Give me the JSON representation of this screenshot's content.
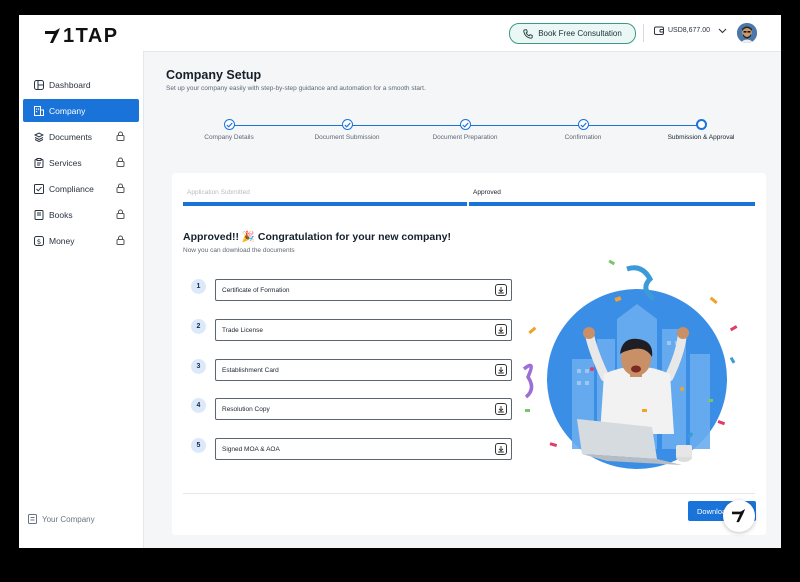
{
  "brand": {
    "logo_text": "1TAP"
  },
  "sidebar": {
    "items": [
      {
        "label": "Dashboard",
        "icon": "dashboard-icon",
        "locked": false,
        "active": false
      },
      {
        "label": "Company",
        "icon": "building-icon",
        "locked": false,
        "active": true
      },
      {
        "label": "Documents",
        "icon": "documents-icon",
        "locked": true,
        "active": false
      },
      {
        "label": "Services",
        "icon": "clipboard-icon",
        "locked": true,
        "active": false
      },
      {
        "label": "Compliance",
        "icon": "compliance-icon",
        "locked": true,
        "active": false
      },
      {
        "label": "Books",
        "icon": "book-icon",
        "locked": true,
        "active": false
      },
      {
        "label": "Money",
        "icon": "dollar-icon",
        "locked": true,
        "active": false
      }
    ],
    "footer_label": "Your Company"
  },
  "topbar": {
    "consult_label": "Book Free Consultation",
    "balance": "USD8,677.00"
  },
  "page": {
    "title": "Company Setup",
    "subtitle": "Set up your company easily with step-by-step guidance and automation for a smooth start."
  },
  "steps": [
    {
      "label": "Company Details",
      "status": "done"
    },
    {
      "label": "Document Submission",
      "status": "done"
    },
    {
      "label": "Document Preparation",
      "status": "done"
    },
    {
      "label": "Confirmation",
      "status": "done"
    },
    {
      "label": "Submission & Approval",
      "status": "current"
    }
  ],
  "progress_tabs": [
    {
      "label": "Application Submitted"
    },
    {
      "label": "Approved"
    }
  ],
  "approval": {
    "title": "Approved!! 🎉 Congratulation for your new company!",
    "subtitle": "Now you can download the documents"
  },
  "documents": [
    {
      "num": "1",
      "name": "Certificate of Formation"
    },
    {
      "num": "2",
      "name": "Trade License"
    },
    {
      "num": "3",
      "name": "Establishment Card"
    },
    {
      "num": "4",
      "name": "Resolution Copy"
    },
    {
      "num": "5",
      "name": "Signed MOA & AOA"
    }
  ],
  "download_label": "Download",
  "colors": {
    "primary": "#1a73d8",
    "consult_border": "#3a9a8a"
  }
}
